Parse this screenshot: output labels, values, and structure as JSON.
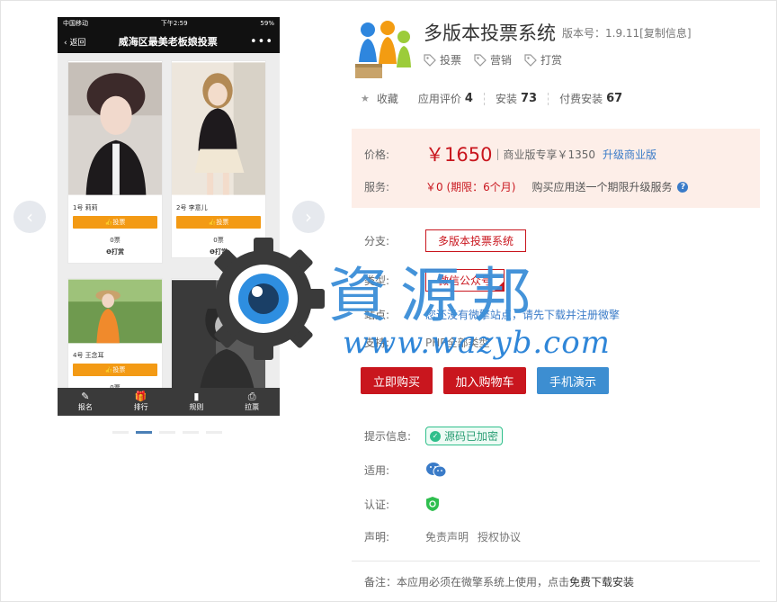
{
  "preview": {
    "statusbar": {
      "carrier": "中国移动",
      "time": "下午2:59",
      "battery": "59%"
    },
    "navbar": {
      "back": "返回",
      "title": "威海区最美老板娘投票",
      "more": "•••"
    },
    "cards": [
      {
        "name": "1号 莉莉",
        "vote": "投票",
        "count": "0票",
        "tip": "打赏"
      },
      {
        "name": "2号 李意儿",
        "vote": "投票",
        "count": "0票",
        "tip": "打赏"
      },
      {
        "name": "4号 王念耳",
        "vote": "投票",
        "count": "0票"
      },
      {
        "name": ""
      }
    ],
    "tabbar": [
      {
        "icon": "edit-icon",
        "label": "报名"
      },
      {
        "icon": "gift-icon",
        "label": "排行"
      },
      {
        "icon": "bar-chart-icon",
        "label": "规则"
      },
      {
        "icon": "ballot-icon",
        "label": "拉票"
      }
    ],
    "carousel": {
      "prev": "‹",
      "next": "›",
      "active_dot": 1,
      "dot_count": 5
    }
  },
  "watermark": {
    "text": "資源邦",
    "url": "www.wazyb.com"
  },
  "app": {
    "title": "多版本投票系统",
    "version": "版本号：1.9.11[复制信息]",
    "tags": [
      "投票",
      "营销",
      "打赏"
    ]
  },
  "stats": {
    "favorite": "收藏",
    "rating_label": "应用评价",
    "rating": "4",
    "install_label": "安装",
    "install": "73",
    "paid_label": "付费安装",
    "paid": "67"
  },
  "pricing": {
    "price_label": "价格:",
    "price": "￥1650",
    "separator": "|",
    "commercial": "商业版专享￥1350",
    "upgrade": "升级商业版",
    "service_label": "服务:",
    "service_value": "￥0 (期限：6个月)",
    "service_note": "购买应用送一个期限升级服务",
    "help": "?"
  },
  "details": {
    "branch_label": "分支:",
    "branch": "多版本投票系统",
    "type_label": "类型:",
    "type": "微信公众号",
    "site_label": "站点:",
    "site": "您还没有微擎站点，请先下载并注册微擎",
    "support_label": "支持:",
    "support": "PHP全部类型"
  },
  "buttons": {
    "buy": "立即购买",
    "cart": "加入购物车",
    "demo": "手机演示"
  },
  "meta": {
    "hint_label": "提示信息:",
    "hint": "源码已加密",
    "apply_label": "适用:",
    "cert_label": "认证:",
    "statement_label": "声明:",
    "disclaimer": "免责声明",
    "license": "授权协议"
  },
  "note": {
    "text": "备注：本应用必须在微擎系统上使用，点击",
    "link": "免费下载安装"
  },
  "colors": {
    "accent_red": "#c9161e",
    "accent_blue": "#3a7bc8",
    "price_bg": "#fdeee8",
    "vote_orange": "#f39a14"
  }
}
